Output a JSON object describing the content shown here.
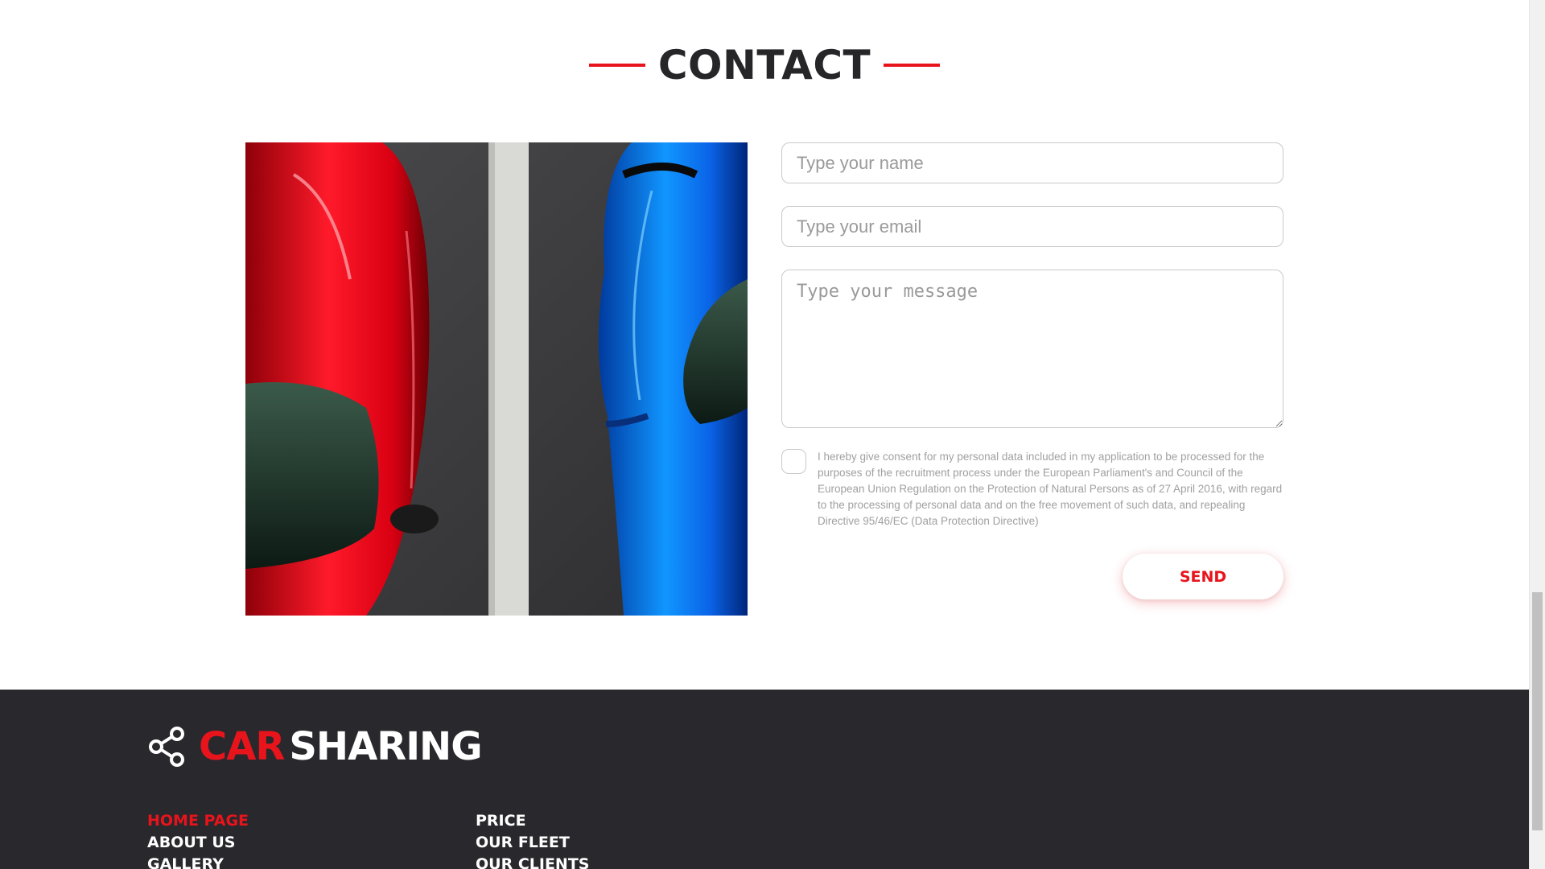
{
  "contact": {
    "heading": "CONTACT"
  },
  "form": {
    "name_placeholder": "Type your name",
    "email_placeholder": "Type your email",
    "message_placeholder": "Type your message",
    "consent_text": "I hereby give consent for my personal data included in my application to be processed for the purposes of the recruitment process under the European Parliament's and Council of the European Union Regulation on the Protection of Natural Persons as of 27 April 2016, with regard to the processing of personal data and on the free movement of such data, and repealing Directive 95/46/EC (Data Protection Directive)",
    "consent_checked": false,
    "send_label": "SEND"
  },
  "footer": {
    "brand_car": "CAR",
    "brand_sharing": "SHARING",
    "brand_icon": "share-icon",
    "nav_col1": [
      "HOME PAGE",
      "ABOUT US",
      "GALLERY"
    ],
    "nav_col2": [
      "PRICE",
      "OUR FLEET",
      "OUR CLIENTS"
    ],
    "active_item": "HOME PAGE"
  },
  "colors": {
    "accent": "#e8141c",
    "footer_bg": "#29282d",
    "heading": "#262528"
  }
}
